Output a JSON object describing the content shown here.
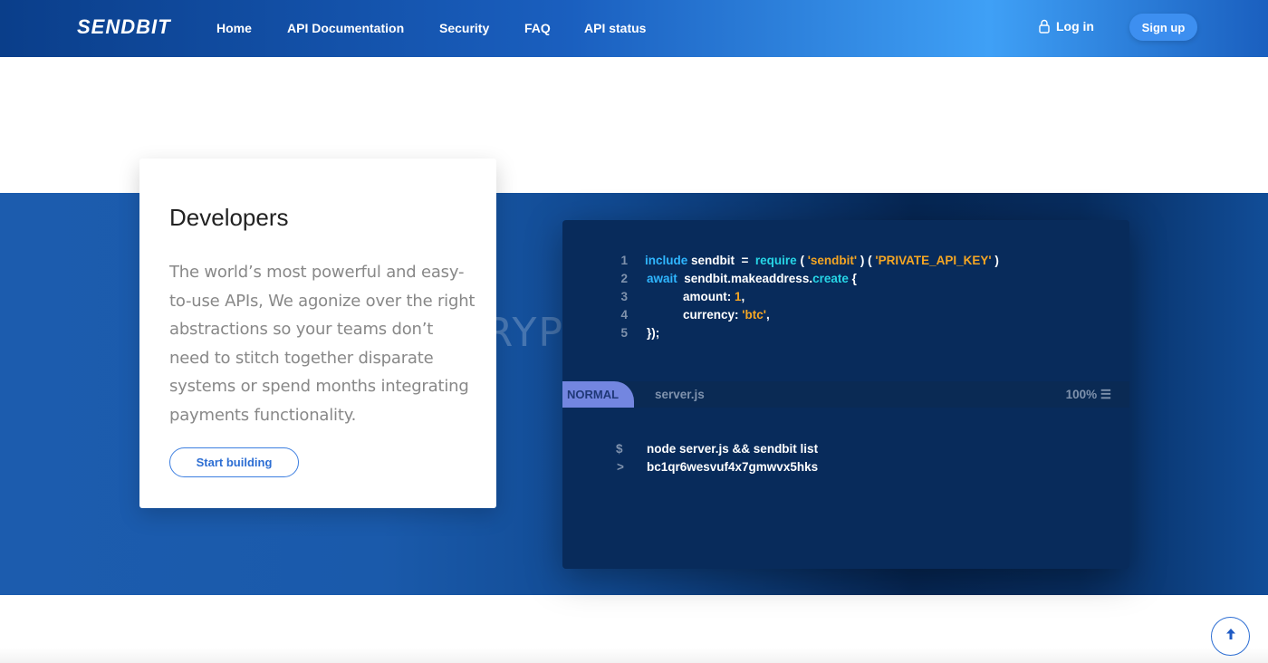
{
  "header": {
    "logo": "SENDBIT",
    "nav": [
      "Home",
      "API Documentation",
      "Security",
      "FAQ",
      "API status"
    ],
    "login_label": "Log in",
    "signup_label": "Sign up"
  },
  "card": {
    "title": "Developers",
    "description": "The world’s most powerful and easy-to-use APIs, We agonize over the right abstractions so your teams don’t need to stitch together disparate systems or spend months integrating payments functionality.",
    "cta_label": "Start building"
  },
  "terminal": {
    "line_numbers": [
      "1",
      "2",
      "3",
      "4",
      "5"
    ],
    "code": {
      "l1_kw": "include",
      "l1_name": " sendbit  =  ",
      "l1_fn": "require",
      "l1_open": " ( ",
      "l1_str1": "'sendbit'",
      "l1_mid": " ) ( ",
      "l1_str2": "'PRIVATE_API_KEY'",
      "l1_close": " )",
      "l2_kw": "await",
      "l2_obj": "  sendbit.makeaddress.",
      "l2_fn": "create",
      "l2_brace": " {",
      "l3_key": "amount: ",
      "l3_val": "1",
      "l3_comma": ",",
      "l4_key": "currency: ",
      "l4_val": "'btc'",
      "l4_comma": ",",
      "l5": "});"
    },
    "status": {
      "mode": "NORMAL",
      "filename": "server.js",
      "zoom": "100% ☰"
    },
    "shell": [
      {
        "prompt": "$",
        "text": "node server.js && sendbit list"
      },
      {
        "prompt": ">",
        "text": "bc1qr6wesvuf4x7gmwvx5hks"
      }
    ]
  },
  "watermark": "CRYPTWERK.COM",
  "colors": {
    "accent": "#3d8ff0",
    "terminal_bg": "#082b5b",
    "keyword": "#2fb6ff",
    "function": "#27d5e6",
    "string": "#f5a623"
  },
  "icons": {
    "login": "user-icon",
    "scroll_top": "arrow-up-icon"
  }
}
